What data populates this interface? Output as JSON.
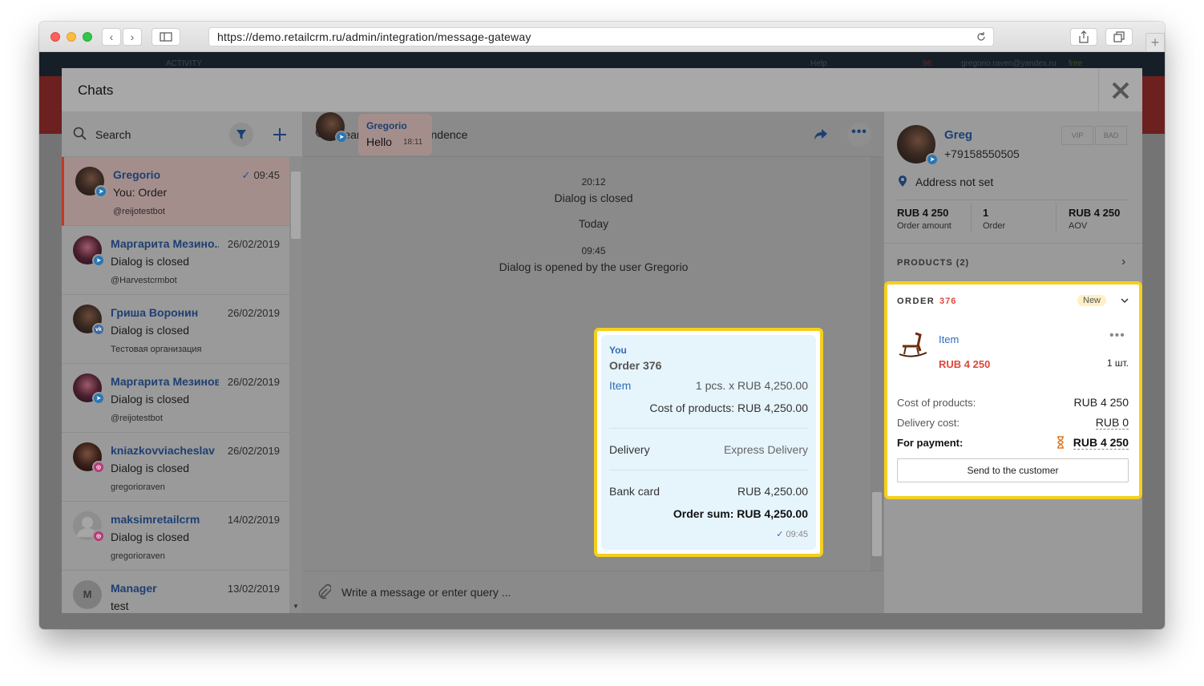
{
  "browser": {
    "url": "https://demo.retailcrm.ru/admin/integration/message-gateway"
  },
  "background": {
    "nav_activity": "ACTIVITY",
    "nav_help": "Help",
    "nav_count": "96",
    "nav_email": "gregorio.raven@yandex.ru",
    "nav_plan": "free"
  },
  "modal": {
    "title": "Chats",
    "left": {
      "search_placeholder": "Search",
      "chats": [
        {
          "name": "Gregorio",
          "time": "09:45",
          "text": "You: Order",
          "sub": "@reijotestbot",
          "channel": "telegram",
          "read": true
        },
        {
          "name": "Маргарита Мезино...",
          "time": "26/02/2019",
          "text": "Dialog is closed",
          "sub": "@Harvestcrmbot",
          "channel": "telegram"
        },
        {
          "name": "Гриша Воронин",
          "time": "26/02/2019",
          "text": "Dialog is closed",
          "sub": "Тестовая организация",
          "channel": "vk"
        },
        {
          "name": "Маргарита Мезинова",
          "time": "26/02/2019",
          "text": "Dialog is closed",
          "sub": "@reijotestbot",
          "channel": "telegram"
        },
        {
          "name": "kniazkovviacheslav",
          "time": "26/02/2019",
          "text": "Dialog is closed",
          "sub": "gregorioraven",
          "channel": "instagram"
        },
        {
          "name": "maksimretailcrm",
          "time": "14/02/2019",
          "text": "Dialog is closed",
          "sub": "gregorioraven",
          "channel": "instagram"
        },
        {
          "name": "Manager",
          "time": "13/02/2019",
          "text": "test",
          "sub": "",
          "initial": "M"
        }
      ]
    },
    "center": {
      "search_placeholder": "Search in correspondence",
      "first_message": {
        "author": "Gregorio",
        "text": "Hello",
        "time": "18:11"
      },
      "system": [
        {
          "time": "20:12",
          "text": "Dialog is closed"
        },
        {
          "time": "",
          "text": "Today"
        },
        {
          "time": "09:45",
          "text": "Dialog is opened by the user Gregorio"
        }
      ],
      "input_placeholder": "Write a message or enter query ..."
    },
    "order_card": {
      "author": "You",
      "title": "Order 376",
      "item_name": "Item",
      "item_qty_price": "1 pcs. x RUB 4,250.00",
      "cost_of_products": "Cost of products: RUB 4,250.00",
      "delivery_label": "Delivery",
      "delivery_value": "Express Delivery",
      "payment_label": "Bank card",
      "payment_value": "RUB 4,250.00",
      "order_sum": "Order sum: RUB 4,250.00",
      "time": "09:45"
    },
    "right": {
      "customer_name": "Greg",
      "phone": "+79158550505",
      "tag_vip": "VIP",
      "tag_bad": "BAD",
      "address": "Address not set",
      "stats": [
        {
          "value": "RUB 4 250",
          "label": "Order amount"
        },
        {
          "value": "1",
          "label": "Order"
        },
        {
          "value": "RUB 4 250",
          "label": "AOV"
        }
      ],
      "products_label": "PRODUCTS (2)",
      "order": {
        "label": "ORDER",
        "number": "376",
        "status": "New",
        "item_name": "Item",
        "item_price": "RUB 4 250",
        "item_qty": "1 шт.",
        "cost_label": "Cost of products:",
        "cost_value": "RUB 4 250",
        "delivery_label": "Delivery cost:",
        "delivery_value": "RUB 0",
        "payment_label": "For payment:",
        "payment_value": "RUB 4 250",
        "send_button": "Send to the customer"
      }
    }
  },
  "colors": {
    "accent_blue": "#2f6db5",
    "highlight_yellow": "#f5cf1e",
    "price_red": "#e0463e",
    "status_new_bg": "#fdf0c4",
    "card_bg": "#e6f4fc"
  }
}
